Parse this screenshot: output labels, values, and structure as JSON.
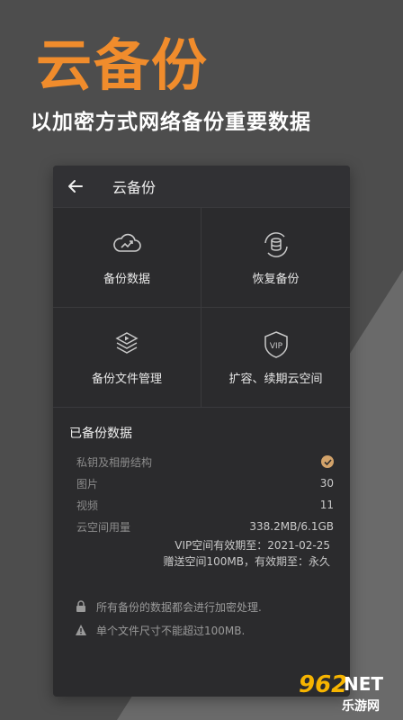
{
  "hero": {
    "title": "云备份",
    "subtitle": "以加密方式网络备份重要数据"
  },
  "topbar": {
    "title": "云备份"
  },
  "actions": [
    {
      "label": "备份数据",
      "icon": "cloud-upload-icon"
    },
    {
      "label": "恢复备份",
      "icon": "database-restore-icon"
    },
    {
      "label": "备份文件管理",
      "icon": "file-stack-play-icon"
    },
    {
      "label": "扩容、续期云空间",
      "icon": "vip-shield-icon"
    }
  ],
  "backed_up": {
    "title": "已备份数据",
    "rows": [
      {
        "key": "私钥及相册结构",
        "value": ""
      },
      {
        "key": "图片",
        "value": "30"
      },
      {
        "key": "视频",
        "value": "11"
      },
      {
        "key": "云空间用量",
        "value": "338.2MB/6.1GB"
      }
    ],
    "vip_expiry": "VIP空间有效期至：2021-02-25",
    "gift_space": "赠送空间100MB，有效期至：永久"
  },
  "notes": [
    {
      "icon": "lock-icon",
      "text": "所有备份的数据都会进行加密处理."
    },
    {
      "icon": "warning-icon",
      "text": "单个文件尺寸不能超过100MB."
    }
  ],
  "watermark": {
    "num": "962",
    "net": "NET",
    "cn": "乐游网"
  },
  "colors": {
    "accent": "#f08c2c",
    "panel": "#2b2b2d",
    "check": "#d3a36a"
  }
}
